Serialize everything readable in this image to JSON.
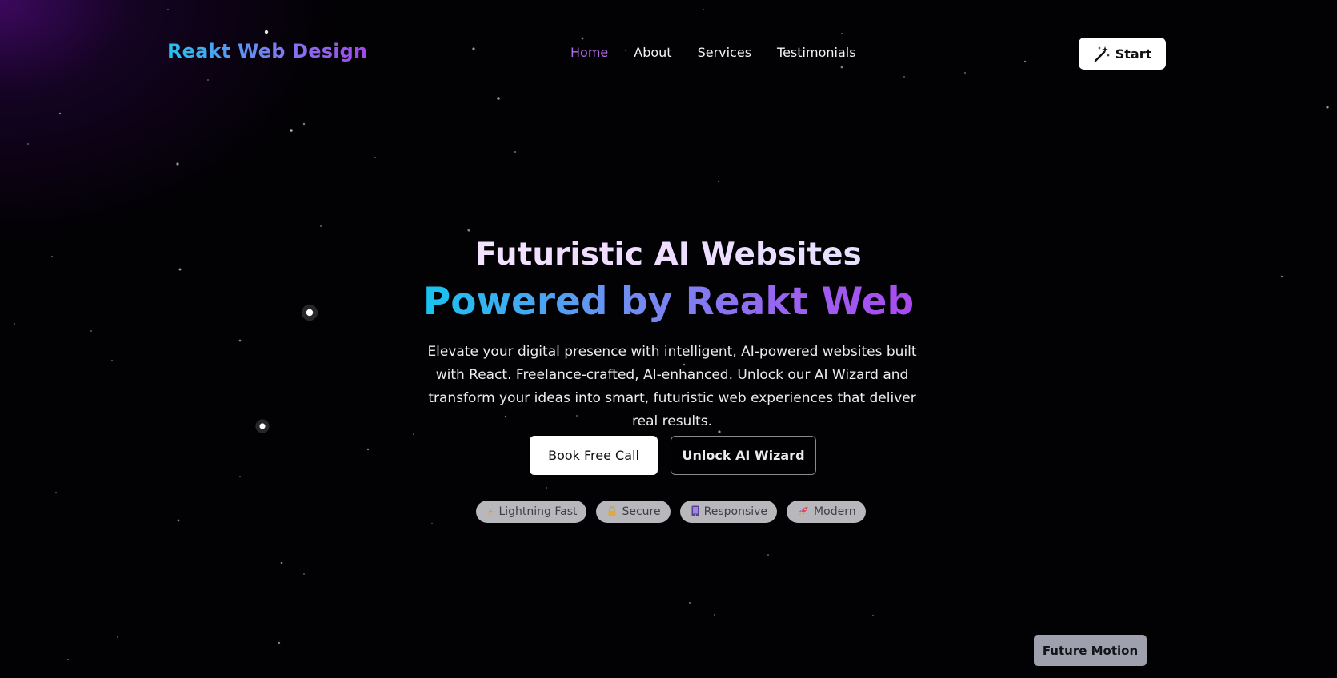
{
  "brand": {
    "name": "Reakt Web Design"
  },
  "nav": {
    "items": [
      {
        "label": "Home",
        "active": true
      },
      {
        "label": "About",
        "active": false
      },
      {
        "label": "Services",
        "active": false
      },
      {
        "label": "Testimonials",
        "active": false
      }
    ],
    "start_label": "Start",
    "start_icon": "magic-wand-icon"
  },
  "hero": {
    "line1": "Futuristic AI Websites",
    "line2": "Powered by Reakt Web",
    "description": "Elevate your digital presence with intelligent, AI-powered websites built with React. Freelance-crafted, AI-enhanced. Unlock our AI Wizard and transform your ideas into smart, futuristic web experiences that deliver real results.",
    "primary_cta": "Book Free Call",
    "secondary_cta": "Unlock AI Wizard"
  },
  "badges": [
    {
      "label": "Lightning Fast",
      "icon": "lightning-icon"
    },
    {
      "label": "Secure",
      "icon": "lock-icon"
    },
    {
      "label": "Responsive",
      "icon": "mobile-icon"
    },
    {
      "label": "Modern",
      "icon": "rocket-icon"
    }
  ],
  "footer_tag": {
    "label": "Future Motion"
  },
  "colors": {
    "background": "#020103",
    "accent_purple": "#b16ce8",
    "gradient_start": "#22c3f0",
    "gradient_end": "#a447ee",
    "badge_bg": "#b8b8bc"
  }
}
